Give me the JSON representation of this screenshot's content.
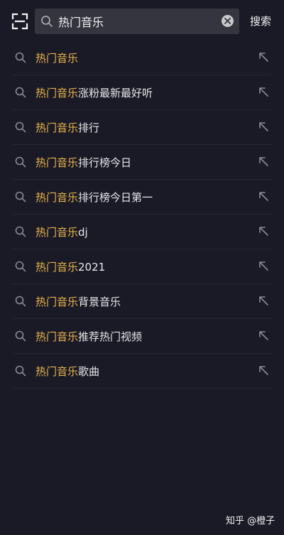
{
  "search": {
    "value": "热门音乐",
    "action_label": "搜索"
  },
  "suggestions": [
    {
      "highlight": "热门音乐",
      "rest": ""
    },
    {
      "highlight": "热门音乐",
      "rest": "涨粉最新最好听"
    },
    {
      "highlight": "热门音乐",
      "rest": "排行"
    },
    {
      "highlight": "热门音乐",
      "rest": "排行榜今日"
    },
    {
      "highlight": "热门音乐",
      "rest": "排行榜今日第一"
    },
    {
      "highlight": "热门音乐",
      "rest": "dj"
    },
    {
      "highlight": "热门音乐",
      "rest": "2021"
    },
    {
      "highlight": "热门音乐",
      "rest": "背景音乐"
    },
    {
      "highlight": "热门音乐",
      "rest": "推荐热门视频"
    },
    {
      "highlight": "热门音乐",
      "rest": "歌曲"
    }
  ],
  "watermark": "知乎 @橙子",
  "colors": {
    "background": "#1a1a26",
    "search_box": "#35353f",
    "highlight": "#e9b44c",
    "text": "#e6e6ea",
    "icon": "#8a8a94"
  },
  "icons": {
    "scan": "scan-icon",
    "search": "search-icon",
    "clear": "clear-icon",
    "fill": "arrow-up-left-icon"
  }
}
